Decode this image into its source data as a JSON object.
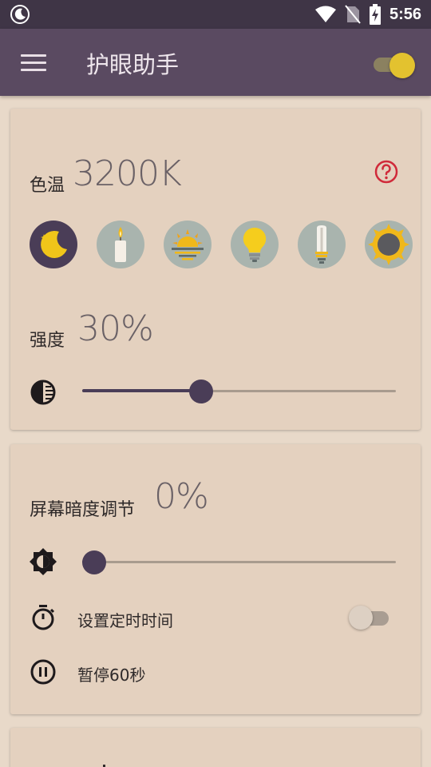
{
  "status_bar": {
    "time": "5:56"
  },
  "app_bar": {
    "title": "护眼助手",
    "master_enabled": true
  },
  "color_temp": {
    "label": "色温",
    "value": "3200K",
    "presets": [
      {
        "icon": "moon-icon",
        "selected": true
      },
      {
        "icon": "candle-icon",
        "selected": false
      },
      {
        "icon": "sunset-icon",
        "selected": false
      },
      {
        "icon": "light-bulb-icon",
        "selected": false
      },
      {
        "icon": "fluorescent-lamp-icon",
        "selected": false
      },
      {
        "icon": "sun-icon",
        "selected": false
      }
    ]
  },
  "intensity": {
    "label": "强度",
    "value": "30%",
    "level": 0.37
  },
  "dim": {
    "label": "屏幕暗度调节",
    "value": "0%",
    "level": 0.0
  },
  "timer": {
    "label": "设置定时时间",
    "enabled": false
  },
  "pause": {
    "label": "暂停60秒"
  },
  "colors": {
    "accent": "#4a3d57",
    "app_bar": "#5a4a61",
    "status_bar": "#3f3546",
    "background": "#e8d9c9",
    "card": "#e4d1bf",
    "toggle_on": "#e3c22f",
    "help": "#d02a3a"
  }
}
